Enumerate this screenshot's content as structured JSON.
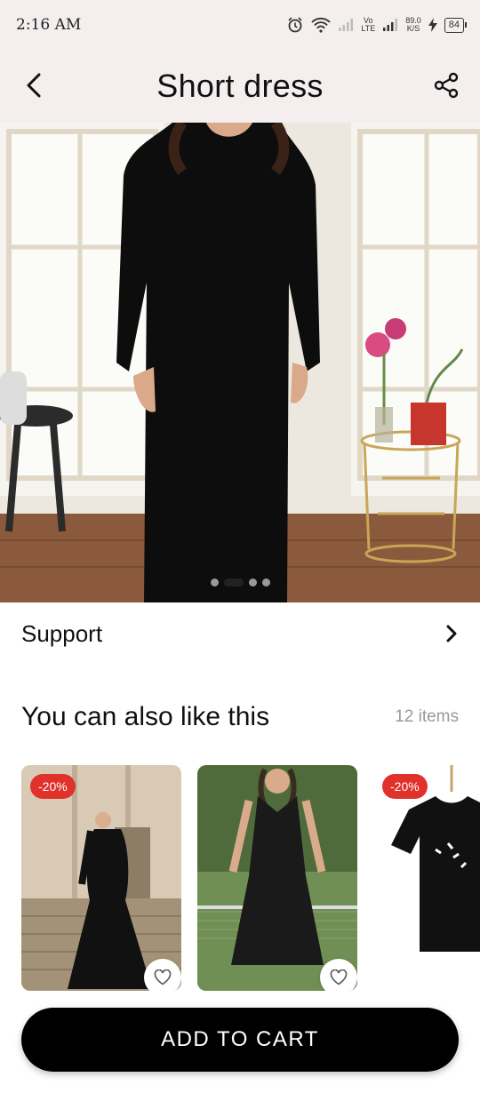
{
  "status_bar": {
    "time": "2:16 AM",
    "lte_top": "Vo",
    "lte_bottom": "LTE",
    "speed_value": "89.0",
    "speed_unit": "K/S",
    "battery": "84"
  },
  "app_bar": {
    "title": "Short dress",
    "back_icon": "chevron-left-icon",
    "share_icon": "share-icon"
  },
  "hero": {
    "slide_count": 4,
    "active_slide": 2
  },
  "support": {
    "label": "Support"
  },
  "recommendations": {
    "title": "You can also like this",
    "count": "12 items",
    "cards": [
      {
        "badge": "-20%",
        "image": "black-gown-photo"
      },
      {
        "badge": "",
        "image": "black-sleeveless-dress-photo"
      },
      {
        "badge": "-20%",
        "image": "black-tshirt-photo"
      }
    ]
  },
  "cart_button": {
    "label": "ADD TO CART"
  },
  "colors": {
    "app_bar_bg": "#f4efee",
    "badge": "#e0322a",
    "button": "#000000"
  }
}
